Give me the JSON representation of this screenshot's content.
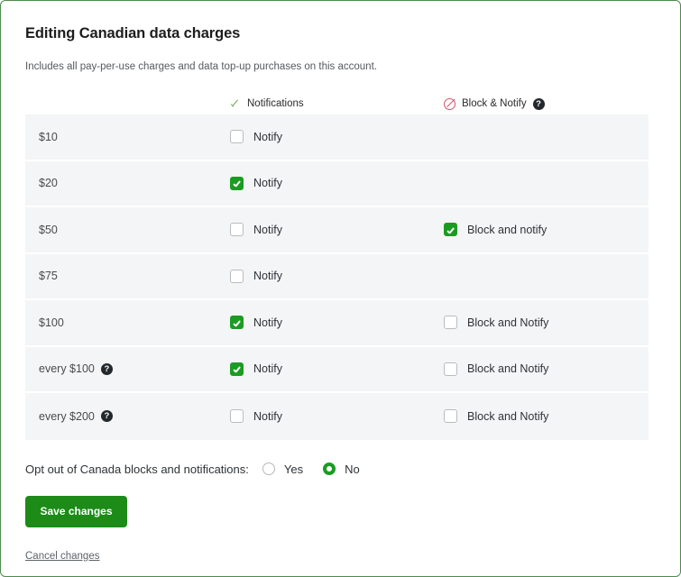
{
  "page": {
    "title": "Editing Canadian data charges",
    "subtitle": "Includes all pay-per-use charges and data top-up purchases on this account."
  },
  "table": {
    "headers": {
      "amount": "",
      "notifications": "Notifications",
      "notifications_icon": "check-icon",
      "block_notify": "Block & Notify",
      "block_notify_icon": "no-entry-icon",
      "block_notify_help": "?"
    },
    "rows": [
      {
        "amount": "$10",
        "amount_help": null,
        "notify": {
          "label": "Notify",
          "checked": false
        },
        "block": {
          "label": "",
          "checked": false,
          "present": false
        }
      },
      {
        "amount": "$20",
        "amount_help": null,
        "notify": {
          "label": "Notify",
          "checked": true
        },
        "block": {
          "label": "",
          "checked": false,
          "present": false
        }
      },
      {
        "amount": "$50",
        "amount_help": null,
        "notify": {
          "label": "Notify",
          "checked": false
        },
        "block": {
          "label": "Block and notify",
          "checked": true,
          "present": true
        }
      },
      {
        "amount": "$75",
        "amount_help": null,
        "notify": {
          "label": "Notify",
          "checked": false
        },
        "block": {
          "label": "",
          "checked": false,
          "present": false
        }
      },
      {
        "amount": "$100",
        "amount_help": null,
        "notify": {
          "label": "Notify",
          "checked": true
        },
        "block": {
          "label": "Block and Notify",
          "checked": false,
          "present": true
        }
      },
      {
        "amount": "every $100",
        "amount_help": "?",
        "notify": {
          "label": "Notify",
          "checked": true
        },
        "block": {
          "label": "Block and Notify",
          "checked": false,
          "present": true
        }
      },
      {
        "amount": "every $200",
        "amount_help": "?",
        "notify": {
          "label": "Notify",
          "checked": false
        },
        "block": {
          "label": "Block and Notify",
          "checked": false,
          "present": true
        }
      }
    ]
  },
  "optout": {
    "label": "Opt out of Canada blocks and notifications:",
    "options": [
      {
        "label": "Yes",
        "selected": false
      },
      {
        "label": "No",
        "selected": true
      }
    ]
  },
  "actions": {
    "save_label": "Save changes",
    "cancel_label": "Cancel changes"
  },
  "colors": {
    "brand_green": "#1c8b18",
    "check_green": "#1c9b23",
    "block_red": "#d4546a",
    "row_grey": "#f4f5f6",
    "page_border": "#4e8a4e"
  }
}
